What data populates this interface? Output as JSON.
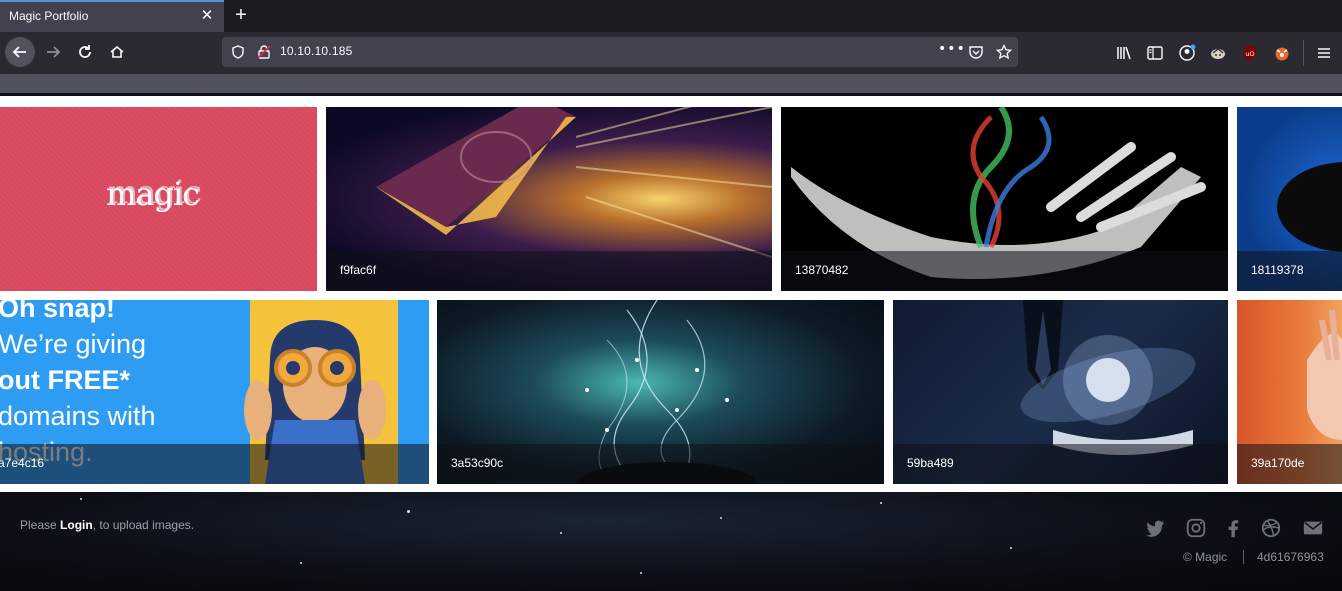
{
  "browser": {
    "tab_title": "Magic Portfolio",
    "url": "10.10.10.185"
  },
  "gallery": {
    "row1": [
      {
        "logo_text": "magic"
      },
      {
        "caption": "f9fac6f"
      },
      {
        "caption": "13870482"
      },
      {
        "caption": "18119378"
      }
    ],
    "row2": [
      {
        "caption": "a7e4c16",
        "ad_text": [
          "Oh snap!",
          "We’re giving",
          "out FREE*",
          "domains with",
          "hosting."
        ]
      },
      {
        "caption": "3a53c90c"
      },
      {
        "caption": "59ba489"
      },
      {
        "caption": "39a170de"
      }
    ]
  },
  "footer": {
    "login_prefix": "Please ",
    "login_link": "Login",
    "login_suffix": ", to upload images.",
    "copyright": "© Magic",
    "hash": "4d61676963",
    "social_icons": [
      "twitter-icon",
      "instagram-icon",
      "facebook-icon",
      "dribbble-icon",
      "mail-icon"
    ]
  },
  "colors": {
    "logo_tile": "#d9485f",
    "chrome_bg": "#2b2a33",
    "tab_active": "#42414d"
  }
}
